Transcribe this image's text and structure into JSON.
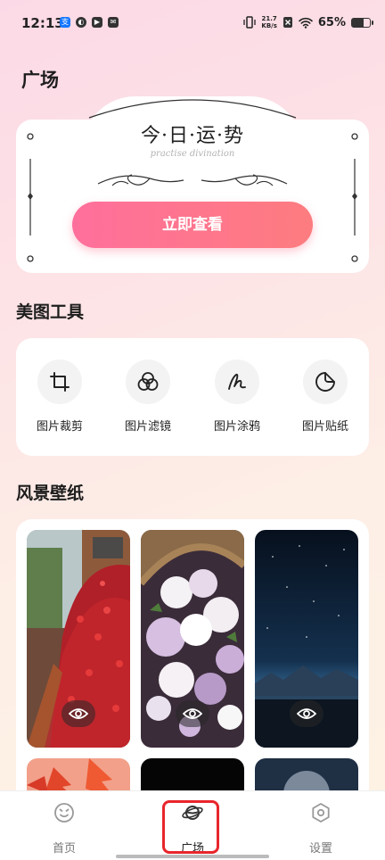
{
  "status_bar": {
    "time": "12:13",
    "net_speed_value": "21.7",
    "net_speed_unit": "KB/s",
    "battery_percent": "65%",
    "battery_level": 0.65
  },
  "page": {
    "title": "广场"
  },
  "fortune": {
    "title": "今·日·运·势",
    "subtitle": "practise divination",
    "button_label": "立即查看",
    "button_gradient": [
      "#ff6f9c",
      "#fd7c7f"
    ]
  },
  "tools": {
    "section_title": "美图工具",
    "items": [
      {
        "label": "图片裁剪",
        "icon": "crop-icon"
      },
      {
        "label": "图片滤镜",
        "icon": "filter-icon"
      },
      {
        "label": "图片涂鸦",
        "icon": "doodle-icon"
      },
      {
        "label": "图片贴纸",
        "icon": "sticker-icon"
      }
    ]
  },
  "wallpapers": {
    "section_title": "风景壁纸",
    "items": [
      {
        "scene": "red flower hedge by brick path"
      },
      {
        "scene": "basket of white and lilac flowers"
      },
      {
        "scene": "starry night over mountain lake"
      },
      {
        "scene": "red maple leaves"
      },
      {
        "scene": "dark sky"
      },
      {
        "scene": "moon at night"
      }
    ]
  },
  "bottom_nav": {
    "items": [
      {
        "label": "首页",
        "icon": "smile-face-icon"
      },
      {
        "label": "广场",
        "icon": "planet-icon",
        "active": true
      },
      {
        "label": "设置",
        "icon": "settings-hexagon-icon"
      }
    ],
    "highlight_color": "#e8262c"
  }
}
